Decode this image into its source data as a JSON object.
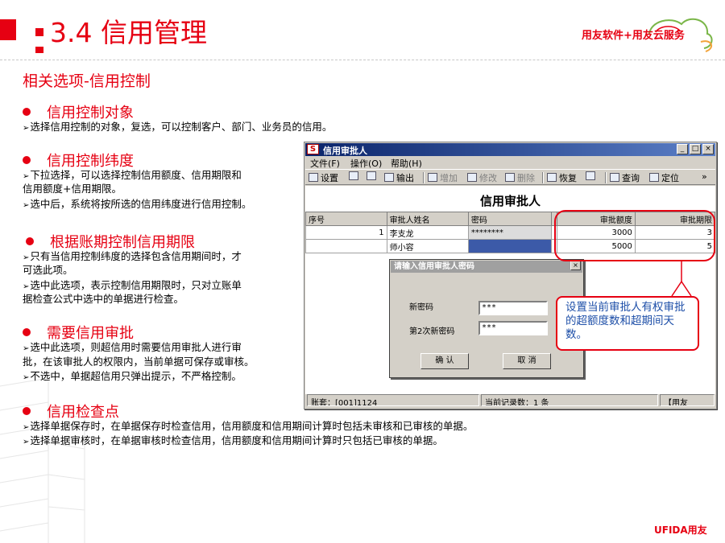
{
  "header": {
    "title": "3.4 信用管理",
    "logo_text": "用友软件+用友云服务"
  },
  "subtitle": "相关选项-信用控制",
  "sections": [
    {
      "heading": "信用控制对象",
      "lines": [
        "选择信用控制的对象，复选，可以控制客户、部门、业务员的信用。"
      ]
    },
    {
      "heading": "信用控制纬度",
      "lines": [
        "下拉选择，可以选择控制信用额度、信用期限和",
        "信用额度+信用期限。",
        "选中后，系统将按所选的信用纬度进行信用控制。"
      ]
    },
    {
      "heading": "根据账期控制信用期限",
      "lines": [
        "只有当信用控制纬度的选择包含信用期间时，才",
        "可选此项。",
        "选中此选项，表示控制信用期限时，只对立账单",
        "据检查公式中选中的单据进行检查。"
      ]
    },
    {
      "heading": "需要信用审批",
      "lines": [
        "选中此选项，则超信用时需要信用审批人进行审",
        "批，在该审批人的权限内，当前单据可保存或审核。",
        "不选中，单据超信用只弹出提示，不严格控制。"
      ]
    },
    {
      "heading": "信用检查点",
      "lines": [
        "选择单据保存时，在单据保存时检查信用，信用额度和信用期间计算时包括未审核和已审核的单据。",
        "选择单据审核时，在单据审核时检查信用，信用额度和信用期间计算时只包括已审核的单据。"
      ]
    }
  ],
  "window": {
    "title": "信用审批人",
    "icon_letter": "S",
    "controls": {
      "minimize": "_",
      "maximize": "□",
      "close": "×"
    },
    "menu": [
      "文件(F)",
      "操作(O)",
      "帮助(H)"
    ],
    "toolbar": [
      {
        "label": "设置",
        "icon": "settings-icon",
        "enabled": true
      },
      {
        "label": "",
        "icon": "print-icon",
        "enabled": true
      },
      {
        "label": "",
        "icon": "preview-icon",
        "enabled": true
      },
      {
        "label": "输出",
        "icon": "export-icon",
        "enabled": true
      },
      {
        "label": "增加",
        "icon": "add-icon",
        "enabled": false
      },
      {
        "label": "修改",
        "icon": "edit-icon",
        "enabled": false
      },
      {
        "label": "删除",
        "icon": "delete-icon",
        "enabled": false
      },
      {
        "label": "恢复",
        "icon": "undo-icon",
        "enabled": true
      },
      {
        "label": "",
        "icon": "save-icon",
        "enabled": true
      },
      {
        "label": "查询",
        "icon": "binoculars-icon",
        "enabled": true
      },
      {
        "label": "定位",
        "icon": "locate-icon",
        "enabled": true
      },
      {
        "label": "»",
        "icon": "more-icon",
        "enabled": true
      }
    ],
    "form_title": "信用审批人",
    "columns": [
      "序号",
      "审批人姓名",
      "密码",
      "",
      "审批额度",
      "审批期限"
    ],
    "rows": [
      {
        "no": "1",
        "name": "李支龙",
        "password": "********",
        "amount": "3000",
        "days": "3"
      },
      {
        "no": "",
        "name": "师小容",
        "password": "",
        "amount": "5000",
        "days": "5"
      }
    ],
    "status": {
      "account": "账套：[001]1124",
      "count": "当前记录数：1 条",
      "brand": "【用友"
    }
  },
  "dialog": {
    "title": "请输入信用审批人密码",
    "close": "×",
    "new_password_label": "新密码",
    "new_password_value": "***",
    "confirm_password_label": "第2次新密码",
    "confirm_password_value": "***",
    "ok_label": "确 认",
    "cancel_label": "取 消"
  },
  "callout": {
    "text": "设置当前审批人有权审批的超额度数和超期间天数。"
  },
  "footer": {
    "logo_text": "UFIDA用友"
  },
  "colors": {
    "accent": "#e60012",
    "callout_text": "#1e4fa8",
    "titlebar": "#0a246a"
  }
}
